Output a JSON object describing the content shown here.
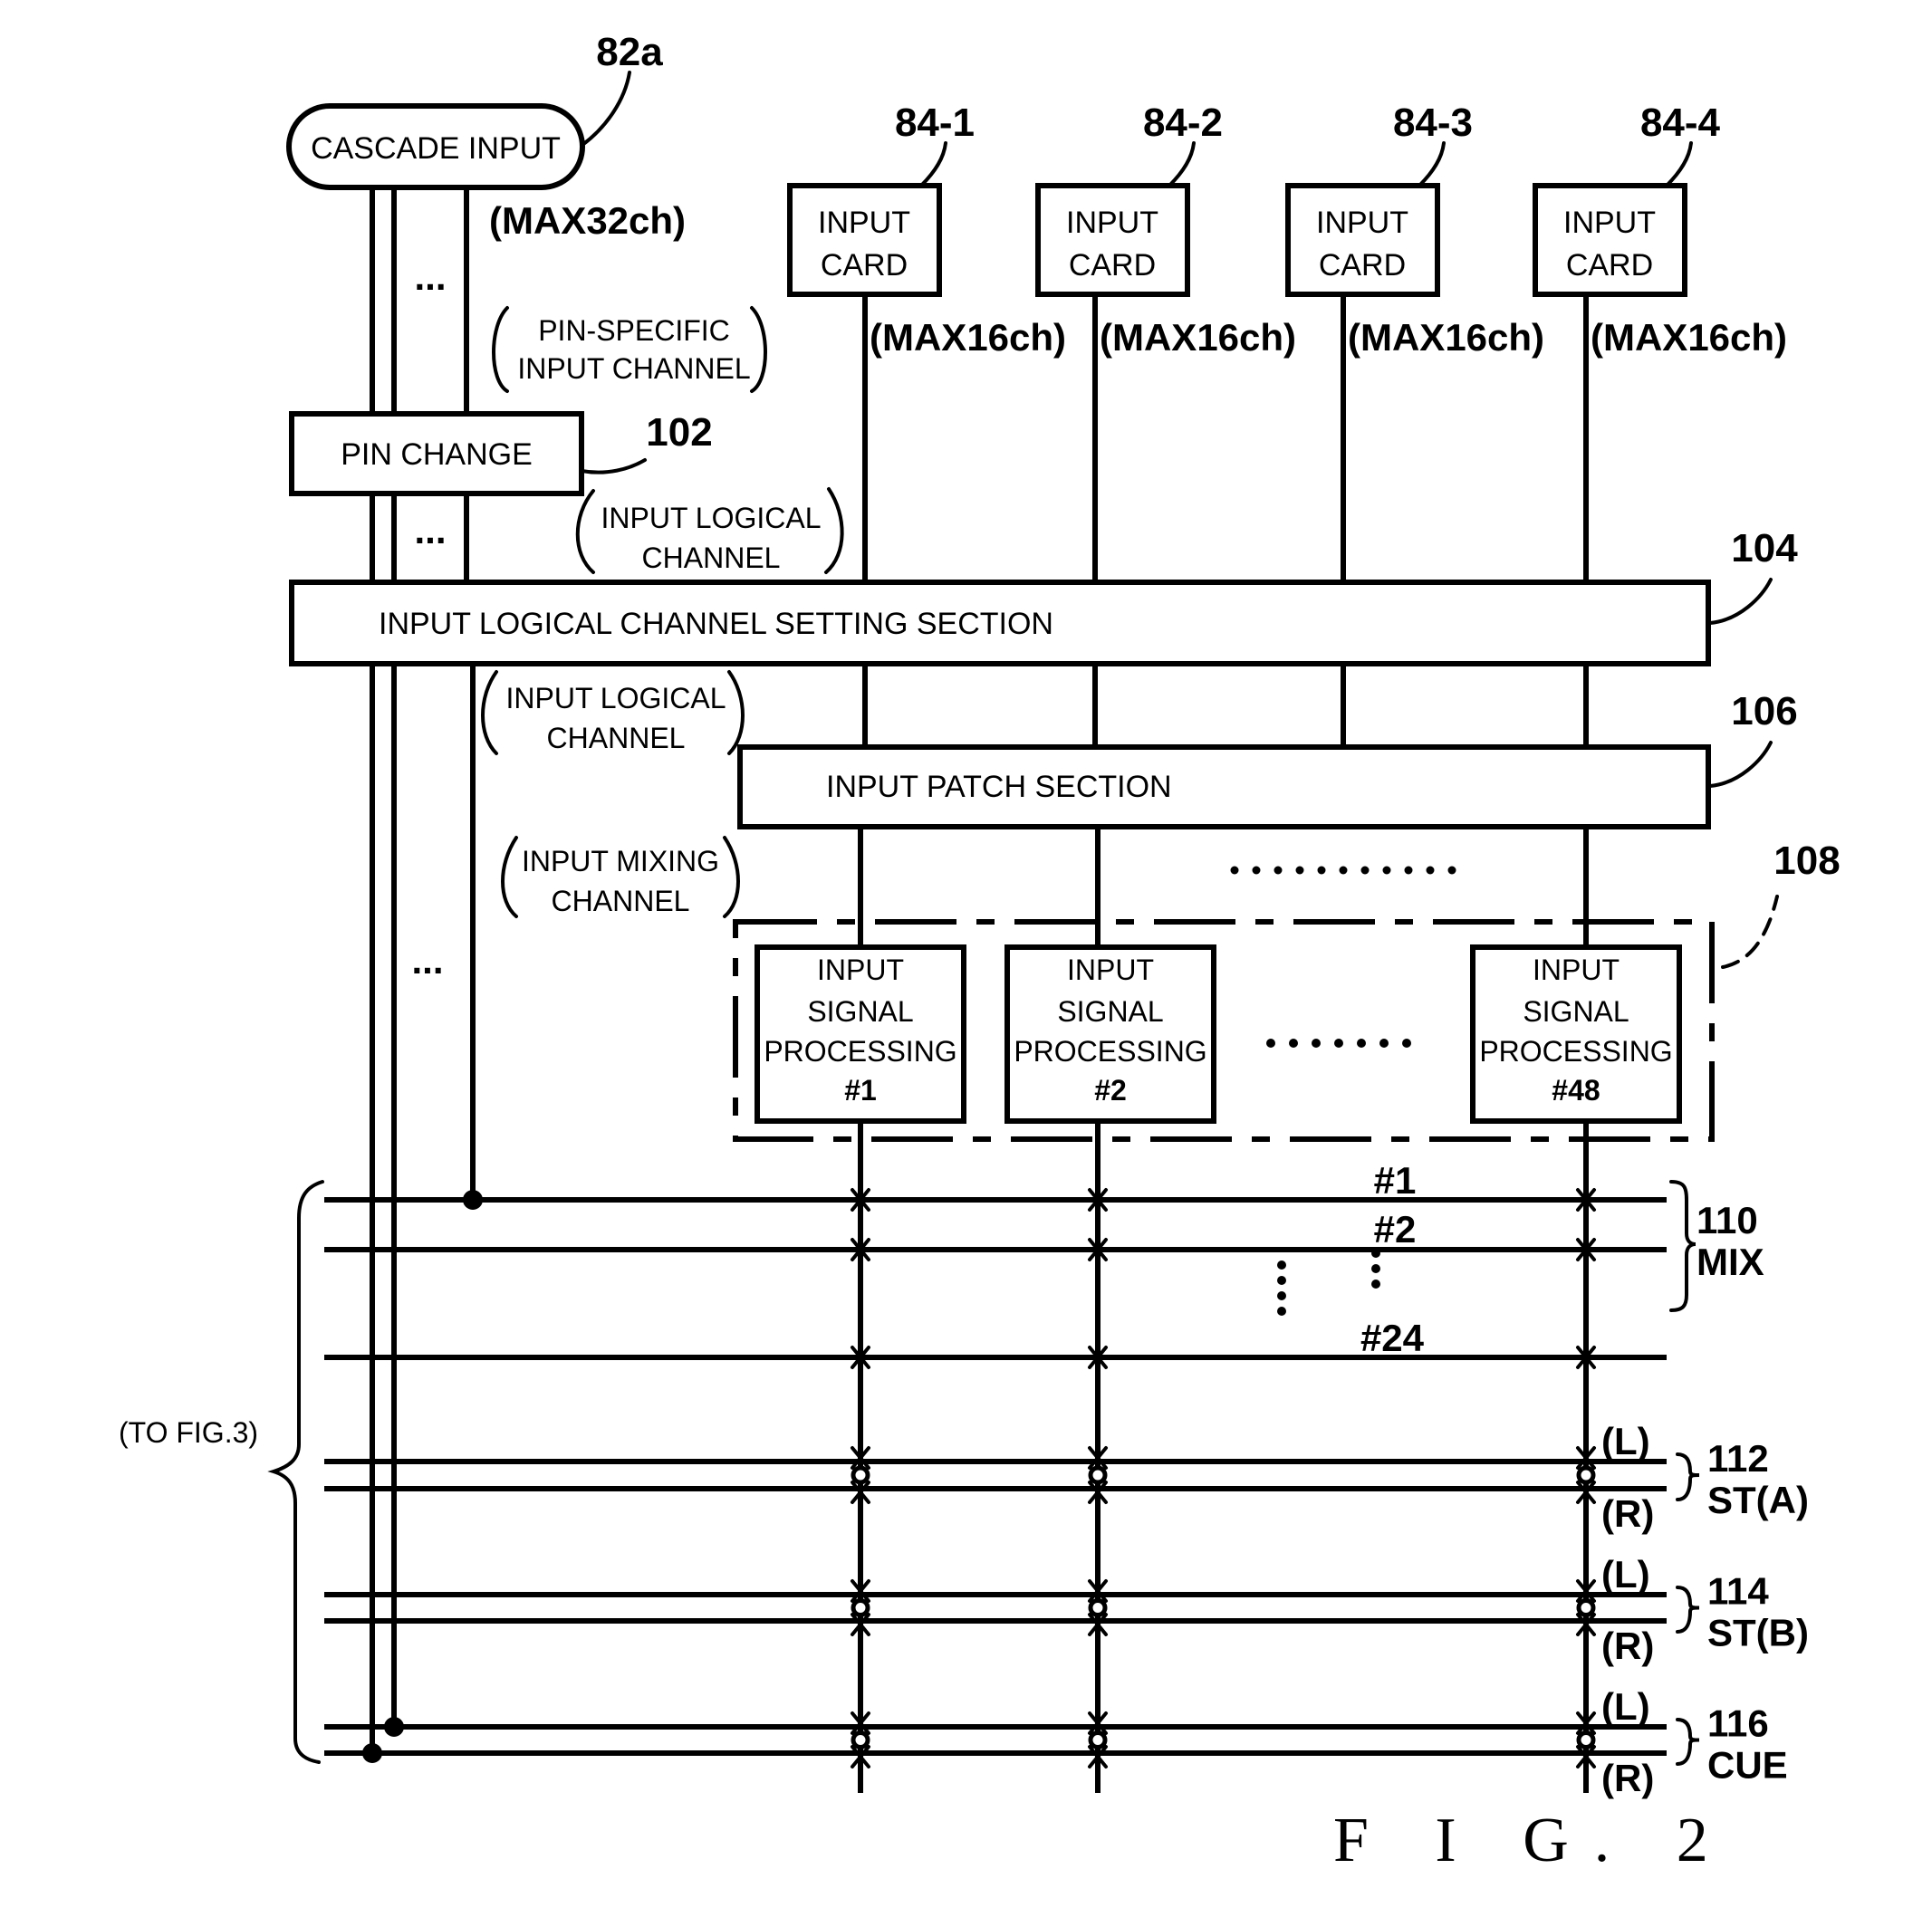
{
  "figure": {
    "caption": "F I G. 2",
    "domain_note": "Patent block diagram of input channel processing"
  },
  "cascade": {
    "label": "CASCADE INPUT",
    "ref": "82a",
    "max_channels": "(MAX32ch)",
    "ellipsis": "..."
  },
  "annotations": {
    "pin_specific_line1": "PIN-SPECIFIC",
    "pin_specific_line2": "INPUT CHANNEL",
    "logical_1_line1": "INPUT LOGICAL",
    "logical_1_line2": "CHANNEL",
    "logical_2_line1": "INPUT LOGICAL",
    "logical_2_line2": "CHANNEL",
    "mixing_line1": "INPUT MIXING",
    "mixing_line2": "CHANNEL",
    "to_fig3": "(TO FIG.3)"
  },
  "input_cards": [
    {
      "ref": "84-1",
      "line1": "INPUT",
      "line2": "CARD",
      "max": "(MAX16ch)"
    },
    {
      "ref": "84-2",
      "line1": "INPUT",
      "line2": "CARD",
      "max": "(MAX16ch)"
    },
    {
      "ref": "84-3",
      "line1": "INPUT",
      "line2": "CARD",
      "max": "(MAX16ch)"
    },
    {
      "ref": "84-4",
      "line1": "INPUT",
      "line2": "CARD",
      "max": "(MAX16ch)"
    }
  ],
  "pin_change": {
    "label": "PIN CHANGE",
    "ref": "102"
  },
  "setting_section": {
    "label": "INPUT LOGICAL CHANNEL SETTING SECTION",
    "ref": "104"
  },
  "patch_section": {
    "label": "INPUT PATCH SECTION",
    "ref": "106"
  },
  "processing": {
    "ref": "108",
    "blocks": [
      {
        "line1": "INPUT",
        "line2": "SIGNAL",
        "line3": "PROCESSING",
        "num": "#1"
      },
      {
        "line1": "INPUT",
        "line2": "SIGNAL",
        "line3": "PROCESSING",
        "num": "#2"
      },
      {
        "line1": "INPUT",
        "line2": "SIGNAL",
        "line3": "PROCESSING",
        "num": "#48"
      }
    ]
  },
  "buses": {
    "mix": {
      "ref": "110",
      "name": "MIX",
      "labels": [
        "#1",
        "#2",
        "#24"
      ]
    },
    "st_a": {
      "ref": "112",
      "name": "ST(A)",
      "left": "(L)",
      "right": "(R)"
    },
    "st_b": {
      "ref": "114",
      "name": "ST(B)",
      "left": "(L)",
      "right": "(R)"
    },
    "cue": {
      "ref": "116",
      "name": "CUE",
      "left": "(L)",
      "right": "(R)"
    }
  }
}
